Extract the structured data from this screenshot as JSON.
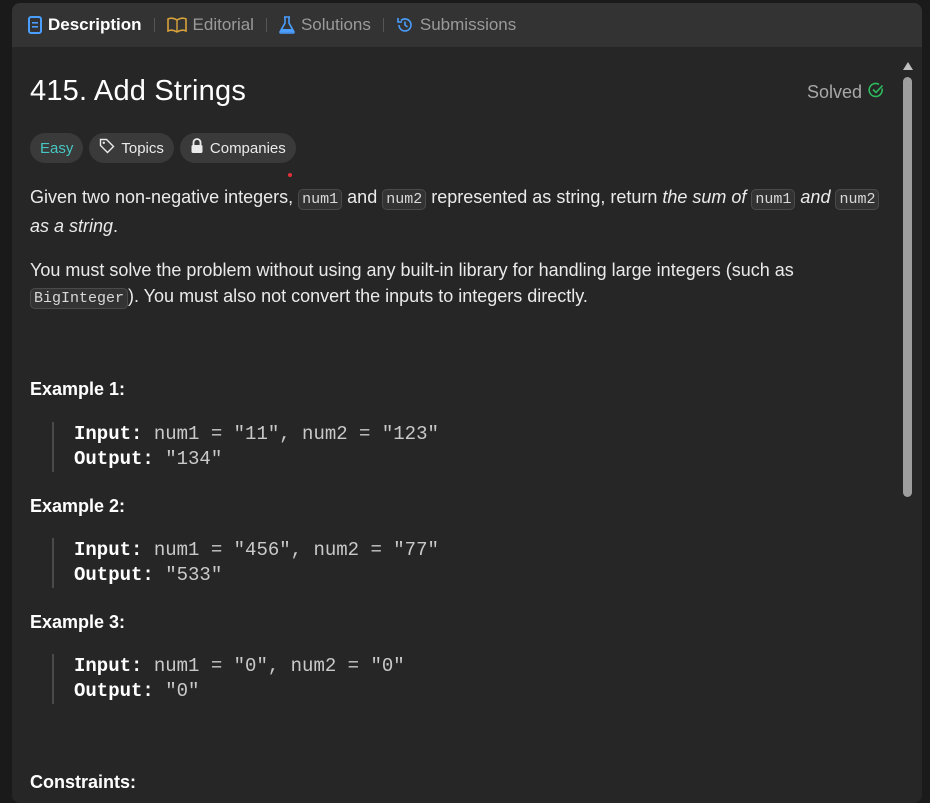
{
  "tabs": [
    {
      "label": "Description"
    },
    {
      "label": "Editorial"
    },
    {
      "label": "Solutions"
    },
    {
      "label": "Submissions"
    }
  ],
  "problem": {
    "title": "415. Add Strings",
    "status": "Solved",
    "tags": {
      "difficulty": "Easy",
      "topics": "Topics",
      "companies": "Companies"
    }
  },
  "description": {
    "p1_a": "Given two non-negative integers, ",
    "p1_code1": "num1",
    "p1_b": " and ",
    "p1_code2": "num2",
    "p1_c": " represented as string, return ",
    "p1_em1": "the sum of ",
    "p1_code3": "num1",
    "p1_em2": " and ",
    "p1_code4": "num2",
    "p1_em3": " as a string",
    "p1_d": ".",
    "p2_a": "You must solve the problem without using any built-in library for handling large integers (such as ",
    "p2_code": "BigInteger",
    "p2_b": "). You must also not convert the inputs to integers directly."
  },
  "examples": [
    {
      "title": "Example 1:",
      "input_label": "Input:",
      "input": " num1 = \"11\", num2 = \"123\"",
      "output_label": "Output:",
      "output": " \"134\""
    },
    {
      "title": "Example 2:",
      "input_label": "Input:",
      "input": " num1 = \"456\", num2 = \"77\"",
      "output_label": "Output:",
      "output": " \"533\""
    },
    {
      "title": "Example 3:",
      "input_label": "Input:",
      "input": " num1 = \"0\", num2 = \"0\"",
      "output_label": "Output:",
      "output": " \"0\""
    }
  ],
  "constraints_title": "Constraints:",
  "colors": {
    "accent_blue": "#4a9eff",
    "editorial_gold": "#d8a33a",
    "easy_teal": "#46c6c2",
    "solved_green": "#2cbb5d"
  }
}
